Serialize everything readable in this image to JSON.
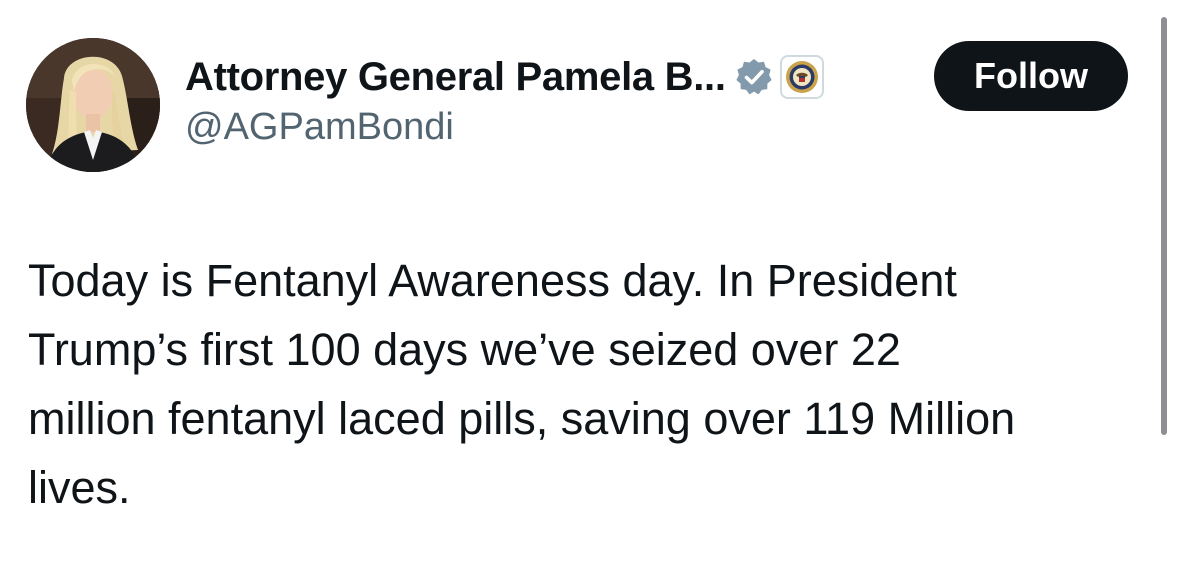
{
  "author": {
    "display_name": "Attorney General Pamela B...",
    "handle": "@AGPamBondi",
    "avatar_icon": "profile-photo",
    "verified_icon": "verified-badge-icon",
    "affiliate_icon": "department-of-justice-seal-icon"
  },
  "actions": {
    "follow_label": "Follow"
  },
  "tweet": {
    "text": "Today is Fentanyl Awareness day. In President\nTrump’s first 100 days we’ve seized over 22\nmillion fentanyl laced pills, saving over 119 Million\nlives."
  },
  "colors": {
    "text_primary": "#0f1419",
    "text_secondary": "#536471",
    "follow_bg": "#0f1419",
    "verified_badge": "#829aab"
  }
}
